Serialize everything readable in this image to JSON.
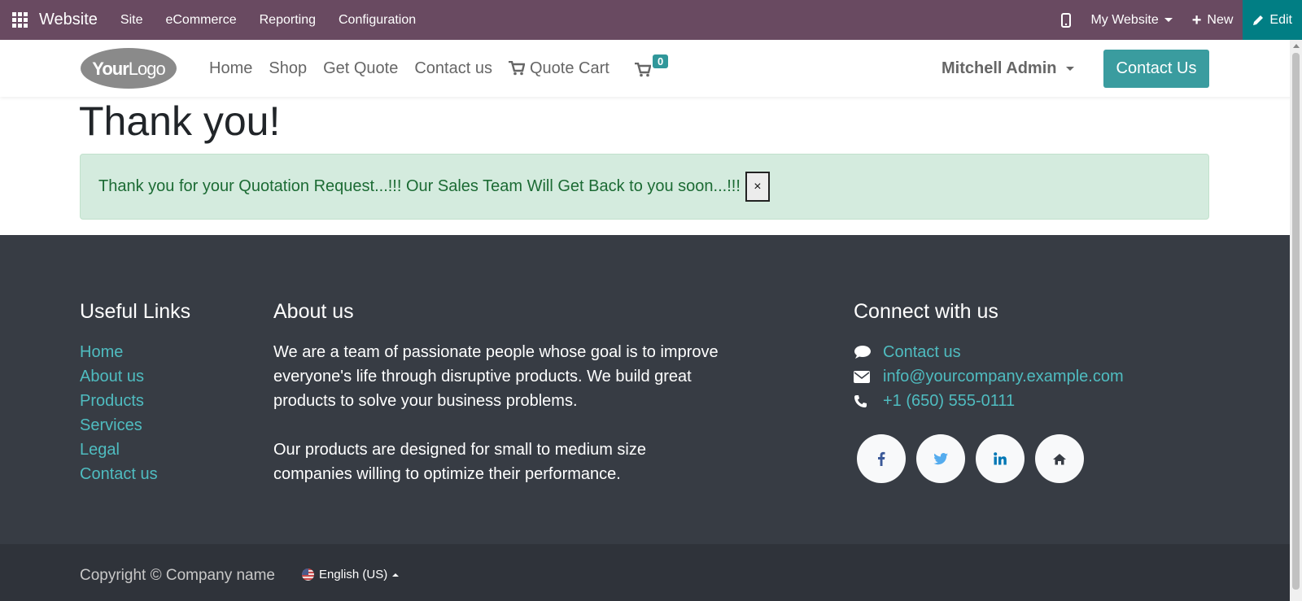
{
  "admin_bar": {
    "app_name": "Website",
    "menus": [
      "Site",
      "eCommerce",
      "Reporting",
      "Configuration"
    ],
    "website_selector": "My Website",
    "new_label": "New",
    "edit_label": "Edit"
  },
  "header": {
    "logo_text": "YourLogo",
    "nav": [
      "Home",
      "Shop",
      "Get Quote",
      "Contact us",
      "Quote Cart"
    ],
    "cart_count": "0",
    "user_name": "Mitchell Admin",
    "cta_label": "Contact Us"
  },
  "main": {
    "title": "Thank you!",
    "alert_text": "Thank you for your Quotation Request...!!! Our Sales Team Will Get Back to you soon...!!!",
    "alert_close": "×"
  },
  "footer": {
    "useful_links_title": "Useful Links",
    "useful_links": [
      "Home",
      "About us",
      "Products",
      "Services",
      "Legal",
      "Contact us"
    ],
    "about_title": "About us",
    "about_paragraphs": [
      "We are a team of passionate people whose goal is to improve everyone's life through disruptive products. We build great products to solve your business problems.",
      "Our products are designed for small to medium size companies willing to optimize their performance."
    ],
    "connect_title": "Connect with us",
    "connect": {
      "contact": "Contact us",
      "email": "info@yourcompany.example.com",
      "phone": "+1 (650) 555-0111"
    },
    "socials": [
      "facebook-icon",
      "twitter-icon",
      "linkedin-icon",
      "home-icon"
    ],
    "copyright": "Copyright © Company name",
    "language": "English (US)"
  },
  "colors": {
    "admin_bar": "#694a61",
    "edit_button": "#017e84",
    "accent": "#3a9c9f",
    "footer_bg": "#373c44",
    "footer_link": "#4fbcc0",
    "alert_bg": "#d4ebde",
    "alert_text": "#1c6b34"
  }
}
